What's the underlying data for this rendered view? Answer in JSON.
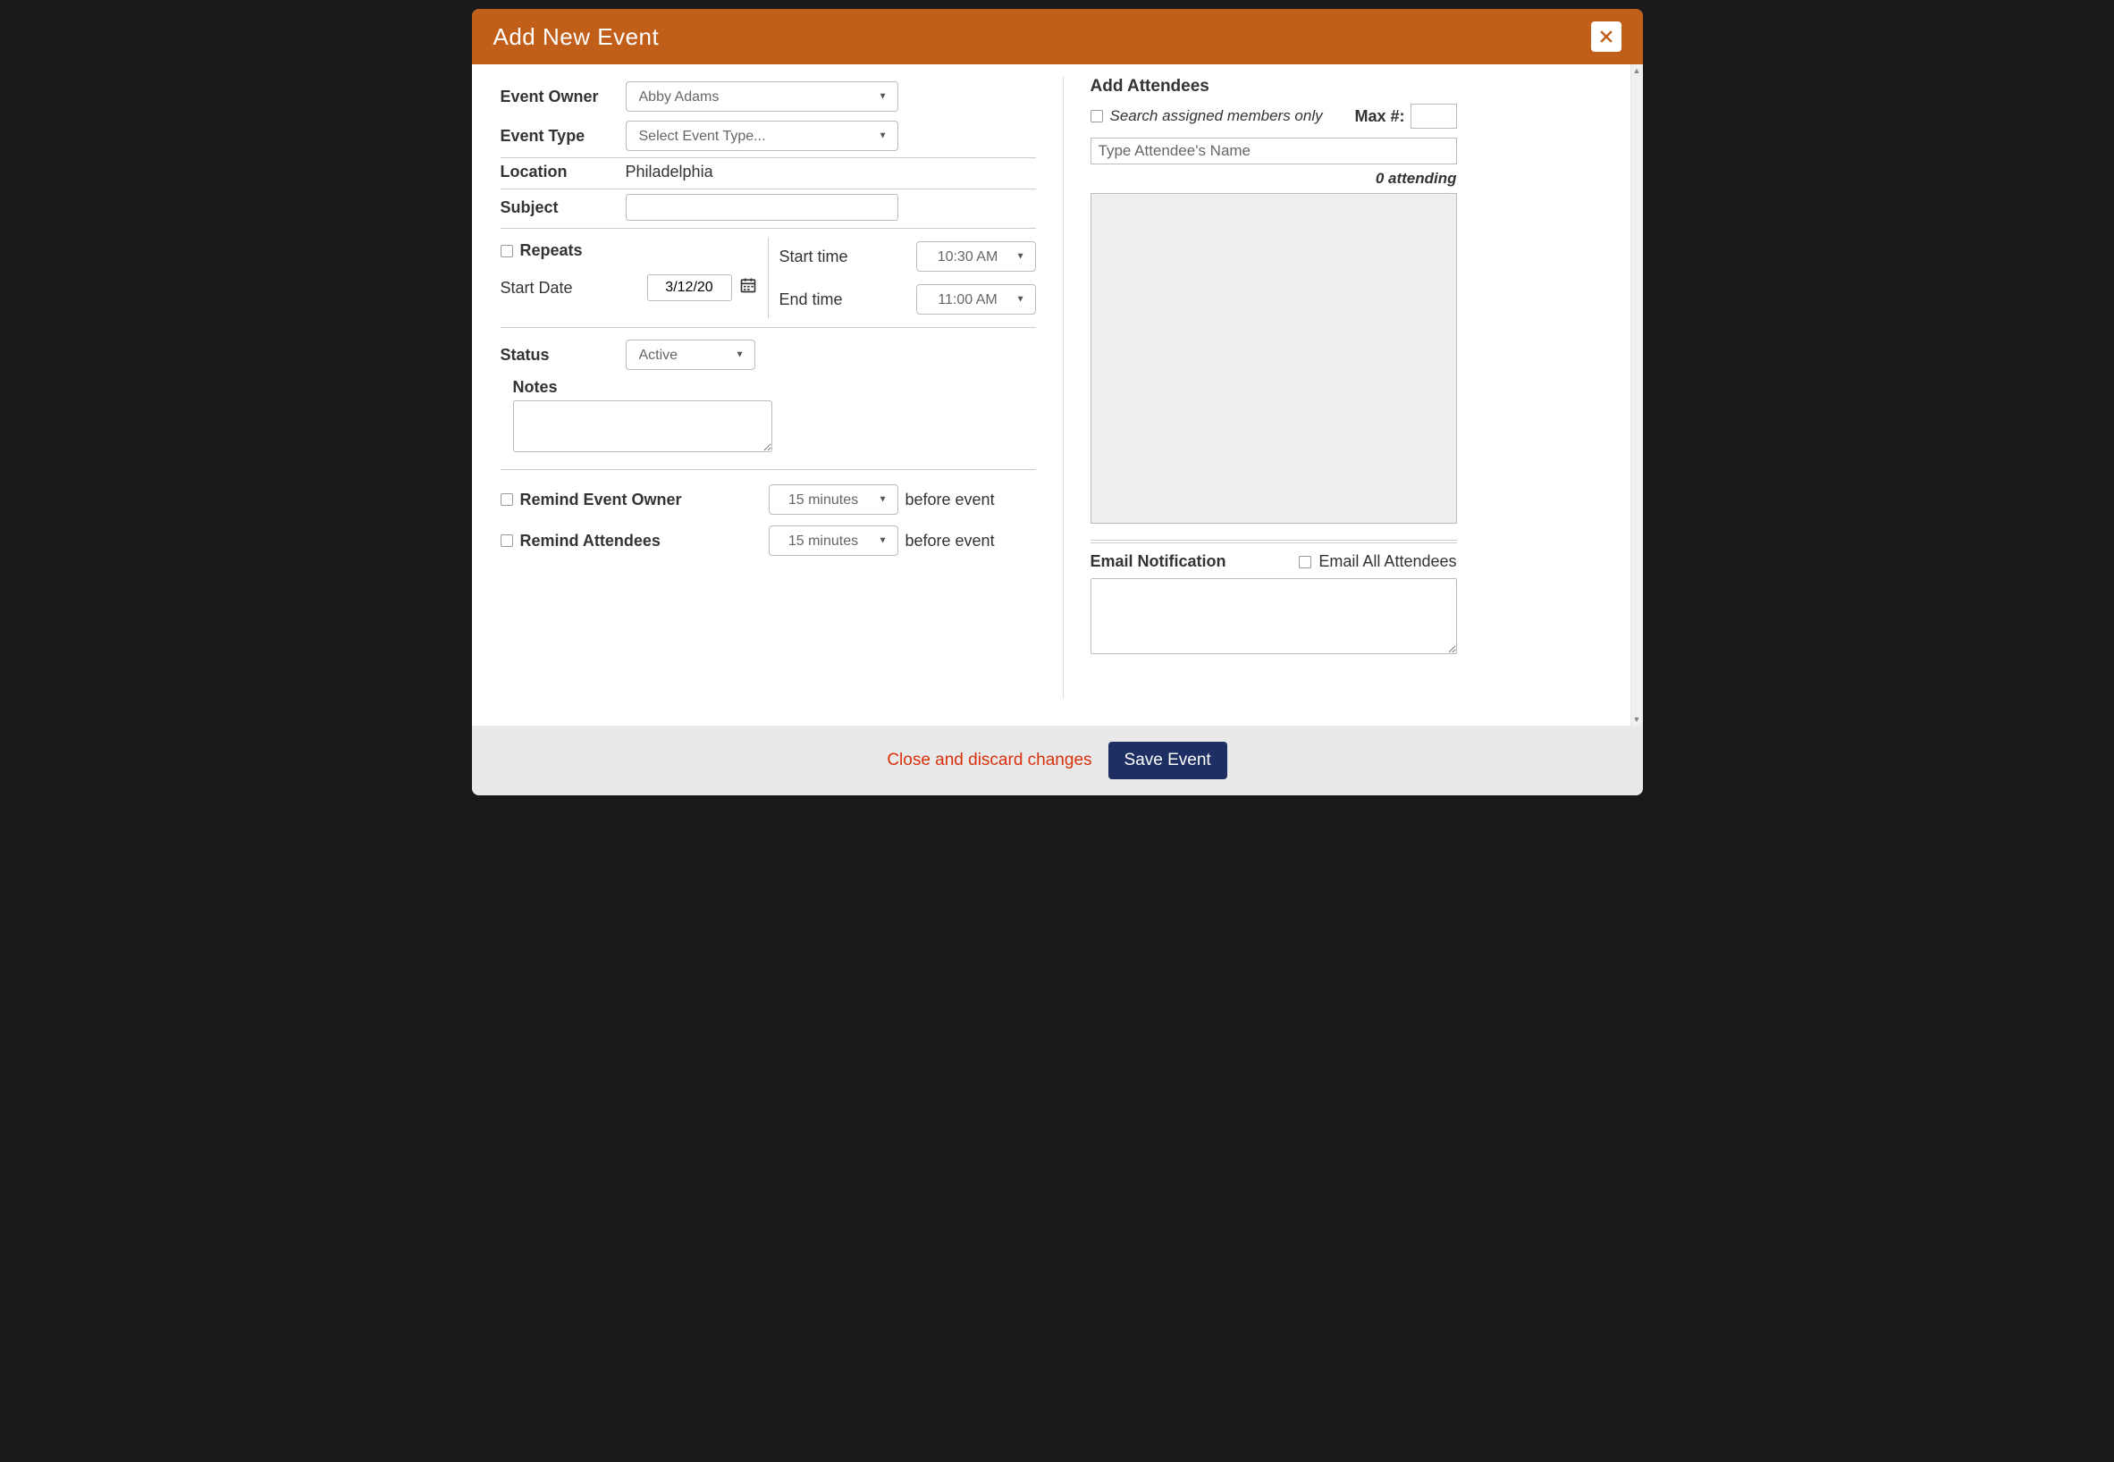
{
  "header": {
    "title": "Add New Event"
  },
  "left": {
    "eventOwnerLabel": "Event Owner",
    "eventOwnerValue": "Abby Adams",
    "eventTypeLabel": "Event Type",
    "eventTypePlaceholder": "Select Event Type...",
    "locationLabel": "Location",
    "locationValue": "Philadelphia",
    "subjectLabel": "Subject",
    "subjectValue": "",
    "repeatsLabel": "Repeats",
    "startDateLabel": "Start Date",
    "startDateValue": "3/12/20",
    "startTimeLabel": "Start time",
    "startTimeValue": "10:30 AM",
    "endTimeLabel": "End time",
    "endTimeValue": "11:00 AM",
    "statusLabel": "Status",
    "statusValue": "Active",
    "notesLabel": "Notes",
    "notesValue": "",
    "remindOwnerLabel": "Remind Event Owner",
    "remindOwnerValue": "15 minutes",
    "remindAttendeesLabel": "Remind Attendees",
    "remindAttendeesValue": "15 minutes",
    "beforeEventText": "before event"
  },
  "right": {
    "addAttendeesLabel": "Add Attendees",
    "searchAssignedLabel": "Search assigned members only",
    "maxLabel": "Max #:",
    "maxValue": "",
    "attendeeInputPlaceholder": "Type Attendee's Name",
    "attendingCount": "0 attending",
    "emailNotificationLabel": "Email Notification",
    "emailAllLabel": "Email All Attendees",
    "emailBody": ""
  },
  "footer": {
    "discard": "Close and discard changes",
    "save": "Save Event"
  }
}
